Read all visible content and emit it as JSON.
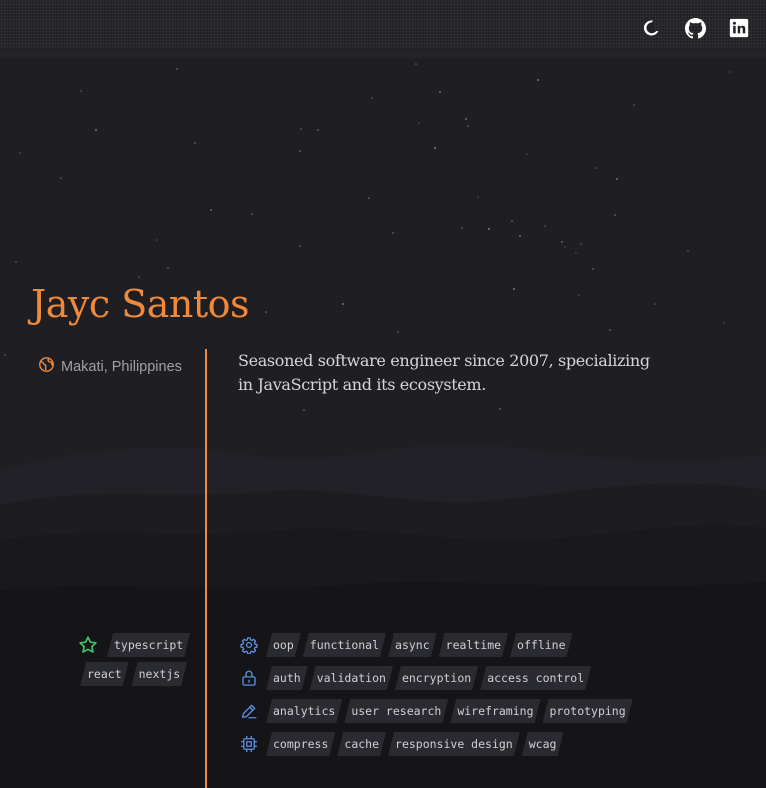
{
  "nav": {
    "theme_icon": "moon-icon",
    "github_icon": "github-icon",
    "linkedin_icon": "linkedin-icon"
  },
  "profile": {
    "name": "Jayc Santos",
    "location": "Makati, Philippines",
    "location_icon": "globe-icon",
    "bio": "Seasoned software engineer since 2007, specializing in JavaScript and its ecosystem."
  },
  "favorites": {
    "icon": "star-icon",
    "tags": [
      "typescript",
      "react",
      "nextjs"
    ]
  },
  "skills": [
    {
      "icon": "gear-icon",
      "tags": [
        "oop",
        "functional",
        "async",
        "realtime",
        "offline"
      ]
    },
    {
      "icon": "lock-icon",
      "tags": [
        "auth",
        "validation",
        "encryption",
        "access control"
      ]
    },
    {
      "icon": "pencil-icon",
      "tags": [
        "analytics",
        "user research",
        "wireframing",
        "prototyping"
      ]
    },
    {
      "icon": "chip-icon",
      "tags": [
        "compress",
        "cache",
        "responsive design",
        "wcag"
      ]
    }
  ],
  "colors": {
    "accent": "#f0893a",
    "star": "#3ec46d",
    "skill_icon": "#5b8fe0",
    "background": "#1f1e22"
  }
}
